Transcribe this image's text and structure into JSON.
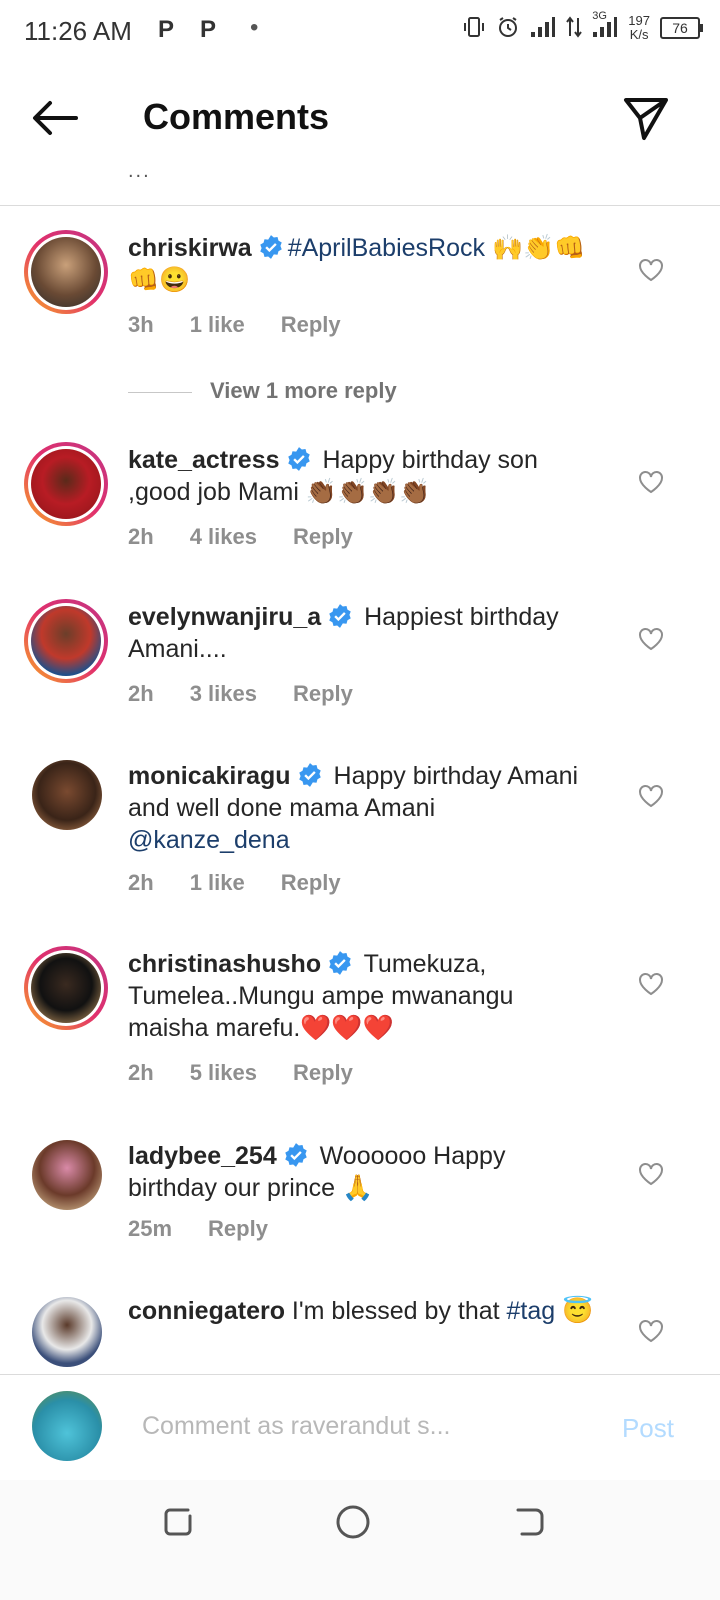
{
  "status": {
    "time": "11:26 AM",
    "notif_icons": [
      "P",
      "P"
    ],
    "dot": "•",
    "network": "3G",
    "speed_value": "197",
    "speed_unit": "K/s",
    "battery": "76"
  },
  "header": {
    "title": "Comments",
    "partial_text": "..."
  },
  "comments": [
    {
      "username": "chriskirwa",
      "verified": true,
      "text": "",
      "hashtag": "#AprilBabiesRock",
      "emoji": " 🙌👏👊👊😀",
      "time": "3h",
      "likes": "1 like",
      "reply": "Reply"
    },
    {
      "username": "kate_actress",
      "verified": true,
      "text": " Happy birthday son ,good job Mami 👏🏾👏🏾👏🏾👏🏾",
      "time": "2h",
      "likes": "4 likes",
      "reply": "Reply"
    },
    {
      "username": "evelynwanjiru_a",
      "verified": true,
      "text": " Happiest birthday Amani....",
      "time": "2h",
      "likes": "3 likes",
      "reply": "Reply"
    },
    {
      "username": "monicakiragu",
      "verified": true,
      "text": " Happy birthday Amani and well done mama Amani ",
      "mention": "@kanze_dena",
      "time": "2h",
      "likes": "1 like",
      "reply": "Reply"
    },
    {
      "username": "christinashusho",
      "verified": true,
      "text": " Tumekuza, Tumelea..Mungu ampe mwanangu maisha marefu.❤️❤️❤️",
      "time": "2h",
      "likes": "5 likes",
      "reply": "Reply"
    },
    {
      "username": "ladybee_254",
      "verified": true,
      "text": " Woooooo Happy birthday our prince 🙏",
      "time": "25m",
      "reply": "Reply"
    },
    {
      "username": "conniegatero",
      "verified": false,
      "text": " I'm blessed by that ",
      "hashtag": "#tag",
      "emoji": " 😇"
    }
  ],
  "view_more": "View 1 more reply",
  "composer": {
    "placeholder": "Comment as raverandut s...",
    "post_label": "Post"
  },
  "colors": {
    "verified_blue": "#3897f0",
    "tag_color": "#1c3e6b",
    "post_disabled": "#b3dbff",
    "meta_gray": "#8e8e8e"
  }
}
